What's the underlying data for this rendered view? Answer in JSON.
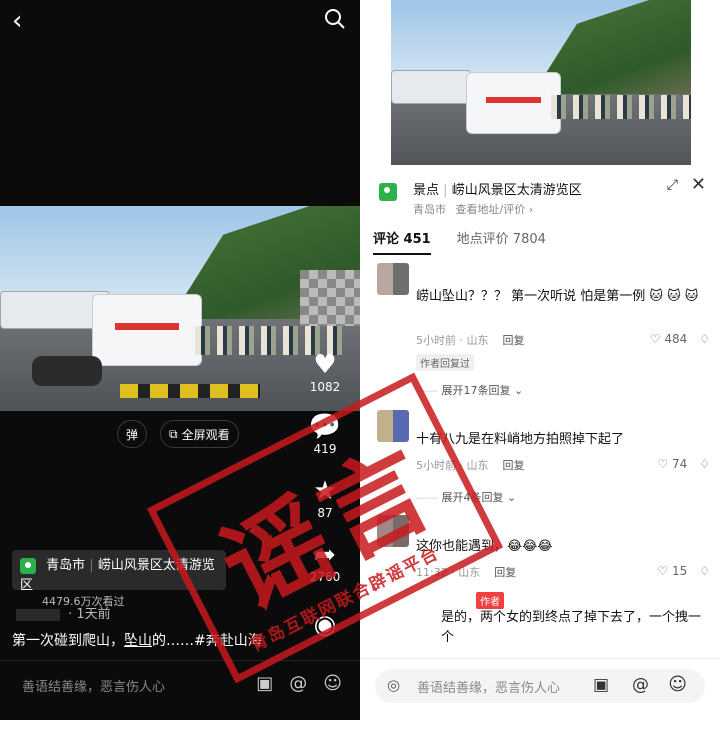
{
  "left": {
    "likes": "1082",
    "comments": "419",
    "favorites": "87",
    "shares": "2760",
    "danmu_label": "弹",
    "fullscreen_label": "全屏观看",
    "location": {
      "city": "青岛市",
      "name": "崂山风景区太清游览区",
      "views": "4479.6万次看过"
    },
    "time": "· 1天前",
    "caption_prefix": "第一次碰到爬山，",
    "caption_highlight": "坠山",
    "caption_suffix": "的……#奔赴山海",
    "input_placeholder": "善语结善缘，恶言伤人心"
  },
  "right": {
    "sheet": {
      "type": "景点",
      "title": "崂山风景区太清游览区",
      "city": "青岛市",
      "subtitle": "查看地址/评价",
      "tabs": [
        {
          "label": "评论 451"
        },
        {
          "label": "地点评价 7804"
        }
      ]
    },
    "comments": [
      {
        "text": "崂山坠山？？？ 第一次听说  怕是第一例 🐱 🐱 🐱",
        "meta": "5小时前 · 山东",
        "reply": "回复",
        "likes": "484",
        "tag": "作者回复过",
        "expand": "展开17条回复"
      },
      {
        "text": "十有八九是在料峭地方拍照掉下起了",
        "meta": "5小时前 · 山东",
        "reply": "回复",
        "likes": "74",
        "expand": "展开4条回复"
      },
      {
        "text": "这你也能遇到，😂😂😂",
        "meta": "11:32 · 山东",
        "reply": "回复",
        "likes": "15"
      },
      {
        "badge": "作者",
        "text": "是的，两个女的到终点了掉下去了，一个拽一个"
      }
    ],
    "input_placeholder": "善语结善缘，恶言伤人心"
  },
  "stamp": {
    "big": "谣言",
    "small": "青岛互联网联合辟谣平台"
  }
}
